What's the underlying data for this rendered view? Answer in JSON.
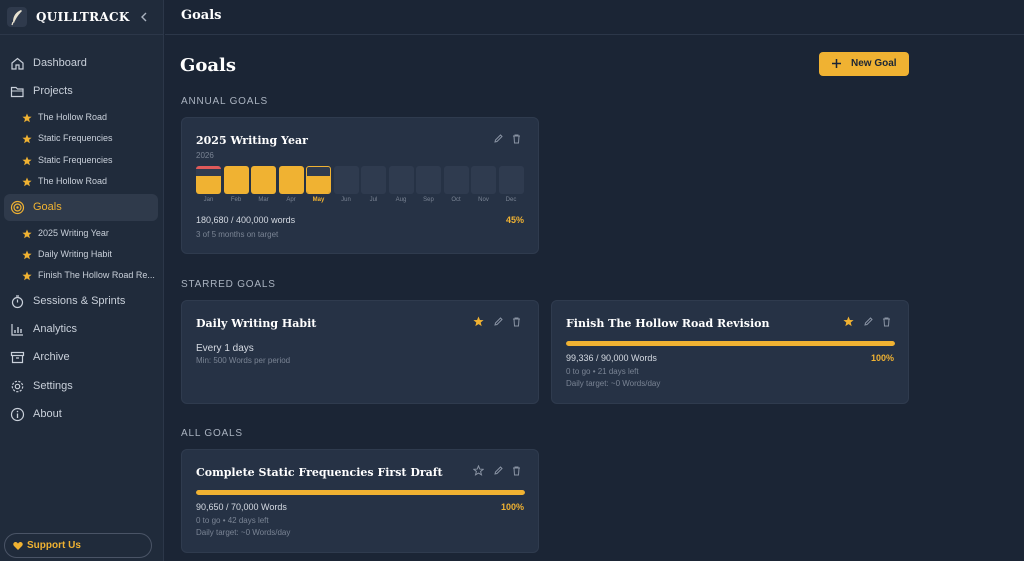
{
  "app": {
    "name": "QUILLTRACK"
  },
  "sidebar": {
    "nav": [
      {
        "label": "Dashboard",
        "icon": "home-icon"
      },
      {
        "label": "Projects",
        "icon": "folder-icon"
      },
      {
        "label": "Goals",
        "icon": "target-icon",
        "active": true
      },
      {
        "label": "Sessions & Sprints",
        "icon": "timer-icon"
      },
      {
        "label": "Analytics",
        "icon": "bar-chart-icon"
      },
      {
        "label": "Archive",
        "icon": "archive-icon"
      },
      {
        "label": "Settings",
        "icon": "gear-icon"
      },
      {
        "label": "About",
        "icon": "info-icon"
      }
    ],
    "projects": [
      "The Hollow Road",
      "Static Frequencies",
      "Static Frequencies",
      "The Hollow Road"
    ],
    "goals": [
      "2025 Writing Year",
      "Daily Writing Habit",
      "Finish The Hollow Road Re..."
    ],
    "support_label": "Support Us"
  },
  "topbar": {
    "title": "Goals"
  },
  "main": {
    "title": "Goals",
    "new_goal_label": "New Goal",
    "sections": {
      "annual": "ANNUAL GOALS",
      "starred": "STARRED GOALS",
      "all": "ALL GOALS"
    }
  },
  "annual_goal": {
    "title": "2025 Writing Year",
    "year": "2026",
    "months": [
      {
        "label": "Jan",
        "fill": 0.65,
        "over": true
      },
      {
        "label": "Feb",
        "fill": 1.0
      },
      {
        "label": "Mar",
        "fill": 1.0
      },
      {
        "label": "Apr",
        "fill": 1.0
      },
      {
        "label": "May",
        "fill": 0.65,
        "current": true
      },
      {
        "label": "Jun",
        "fill": 0
      },
      {
        "label": "Jul",
        "fill": 0
      },
      {
        "label": "Aug",
        "fill": 0
      },
      {
        "label": "Sep",
        "fill": 0
      },
      {
        "label": "Oct",
        "fill": 0
      },
      {
        "label": "Nov",
        "fill": 0
      },
      {
        "label": "Dec",
        "fill": 0
      }
    ],
    "progress_text": "180,680 / 400,000 words",
    "percent": "45%",
    "on_target": "3 of 5 months on target"
  },
  "starred": [
    {
      "title": "Daily Writing Habit",
      "frequency": "Every 1 days",
      "minimum": "Min: 500 Words per period",
      "starred": true
    },
    {
      "title": "Finish The Hollow Road Revision",
      "progress_text": "99,336 / 90,000 Words",
      "percent": "100%",
      "progress": 1.0,
      "remaining": "0 to go • 21 days left",
      "daily": "Daily target: ~0 Words/day",
      "starred": true
    }
  ],
  "all_goals": [
    {
      "title": "Complete Static Frequencies First Draft",
      "progress_text": "90,650 / 70,000 Words",
      "percent": "100%",
      "progress": 1.0,
      "remaining": "0 to go • 42 days left",
      "daily": "Daily target: ~0 Words/day",
      "starred": false
    }
  ],
  "colors": {
    "accent": "#f0b232",
    "background": "#1b2535",
    "card": "#263245",
    "danger": "#e05a5a"
  }
}
